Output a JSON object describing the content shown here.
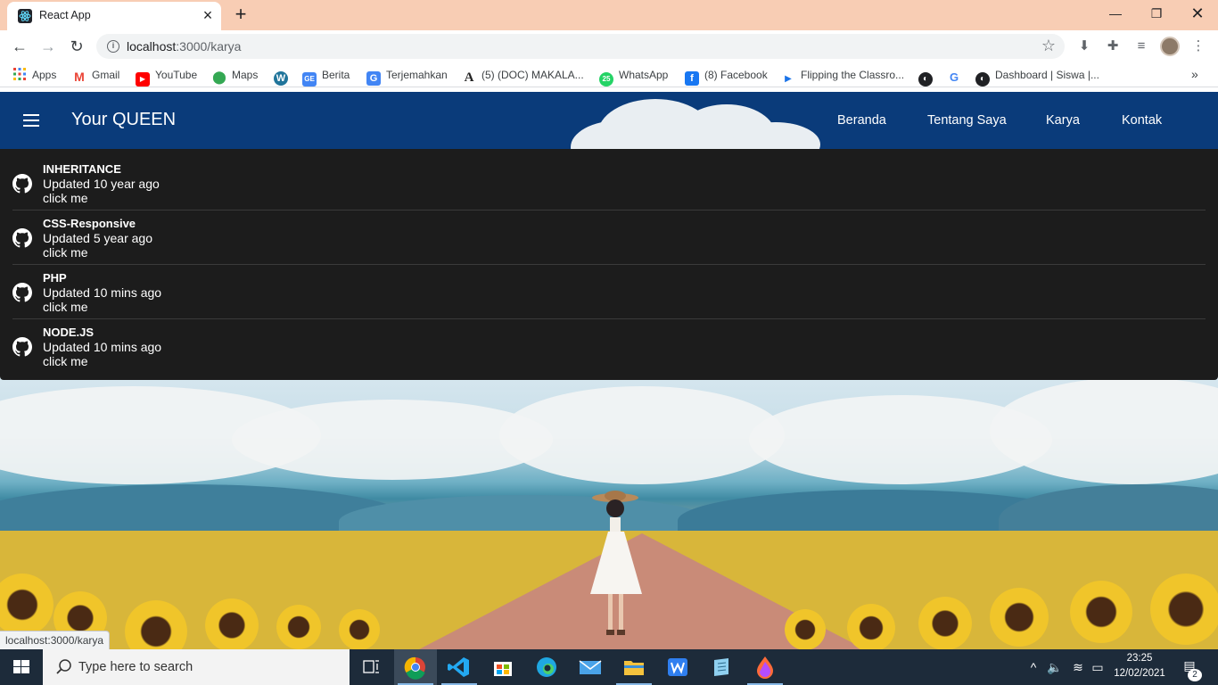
{
  "browser": {
    "tab_title": "React App",
    "url_host": "localhost",
    "url_rest": ":3000/karya",
    "status_url": "localhost:3000/karya"
  },
  "bookmarks": [
    {
      "label": "Apps",
      "icon": "apps-grid-icon",
      "color": "#4285f4"
    },
    {
      "label": "Gmail",
      "icon": "gmail-icon",
      "color": "#ea4335"
    },
    {
      "label": "YouTube",
      "icon": "youtube-icon",
      "color": "#ff0000"
    },
    {
      "label": "Maps",
      "icon": "maps-pin-icon",
      "color": "#34a853"
    },
    {
      "label": "",
      "icon": "wordpress-icon",
      "color": "#21759b"
    },
    {
      "label": "Berita",
      "icon": "google-news-icon",
      "color": "#4285f4"
    },
    {
      "label": "Terjemahkan",
      "icon": "google-translate-icon",
      "color": "#4285f4"
    },
    {
      "label": "(5) (DOC) MAKALA...",
      "icon": "academia-icon",
      "color": "#222222"
    },
    {
      "label": "WhatsApp",
      "icon": "whatsapp-icon",
      "color": "#25d366",
      "badge": "25"
    },
    {
      "label": "(8) Facebook",
      "icon": "facebook-icon",
      "color": "#1877f2"
    },
    {
      "label": "Flipping the Classro...",
      "icon": "video-play-icon",
      "color": "#1a73e8"
    },
    {
      "label": "",
      "icon": "globe-icon",
      "color": "#202124"
    },
    {
      "label": "",
      "icon": "google-icon",
      "color": "#4285f4"
    },
    {
      "label": "Dashboard | Siswa |...",
      "icon": "globe-icon",
      "color": "#202124"
    }
  ],
  "app": {
    "brand": "Your QUEEN",
    "nav": [
      "Beranda",
      "Tentang Saya",
      "Karya",
      "Kontak"
    ]
  },
  "repos": [
    {
      "name": "INHERITANCE",
      "updated": "Updated 10 year ago",
      "action": "click me"
    },
    {
      "name": "CSS-Responsive",
      "updated": "Updated 5 year ago",
      "action": "click me"
    },
    {
      "name": "PHP",
      "updated": "Updated 10 mins ago",
      "action": "click me"
    },
    {
      "name": "NODE.JS",
      "updated": "Updated 10 mins ago",
      "action": "click me"
    }
  ],
  "taskbar": {
    "search_placeholder": "Type here to search",
    "time": "23:25",
    "date": "12/02/2021",
    "notification_count": "2",
    "apps": [
      "task-view-icon",
      "chrome-icon",
      "vscode-icon",
      "store-icon",
      "edge-icon",
      "mail-icon",
      "file-explorer-icon",
      "wps-writer-icon",
      "notepad-icon",
      "paint-drop-icon"
    ]
  },
  "colors": {
    "appbar": "#0a3b7a",
    "list_bg": "#1c1c1c",
    "tab_strip": "#f8cdb4",
    "taskbar": "#1d2b3a"
  }
}
